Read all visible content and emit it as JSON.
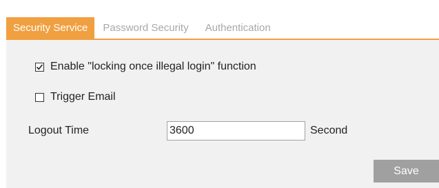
{
  "tabs": [
    {
      "label": "Security Service",
      "active": true
    },
    {
      "label": "Password Security",
      "active": false
    },
    {
      "label": "Authentication",
      "active": false
    }
  ],
  "form": {
    "lock_label": "Enable \"locking once illegal login\" function",
    "lock_checked": true,
    "email_label": "Trigger Email",
    "email_checked": false,
    "logout_label": "Logout Time",
    "logout_value": "3600",
    "logout_unit": "Second"
  },
  "actions": {
    "save_label": "Save"
  },
  "colors": {
    "accent": "#f0a040",
    "panel_bg": "#f1f1f1",
    "button_bg": "#a0a0a0",
    "inactive_tab_text": "#a8a8a8"
  },
  "icons": {
    "lock_checkbox": "checkbox-checked-icon",
    "email_checkbox": "checkbox-empty-icon"
  }
}
